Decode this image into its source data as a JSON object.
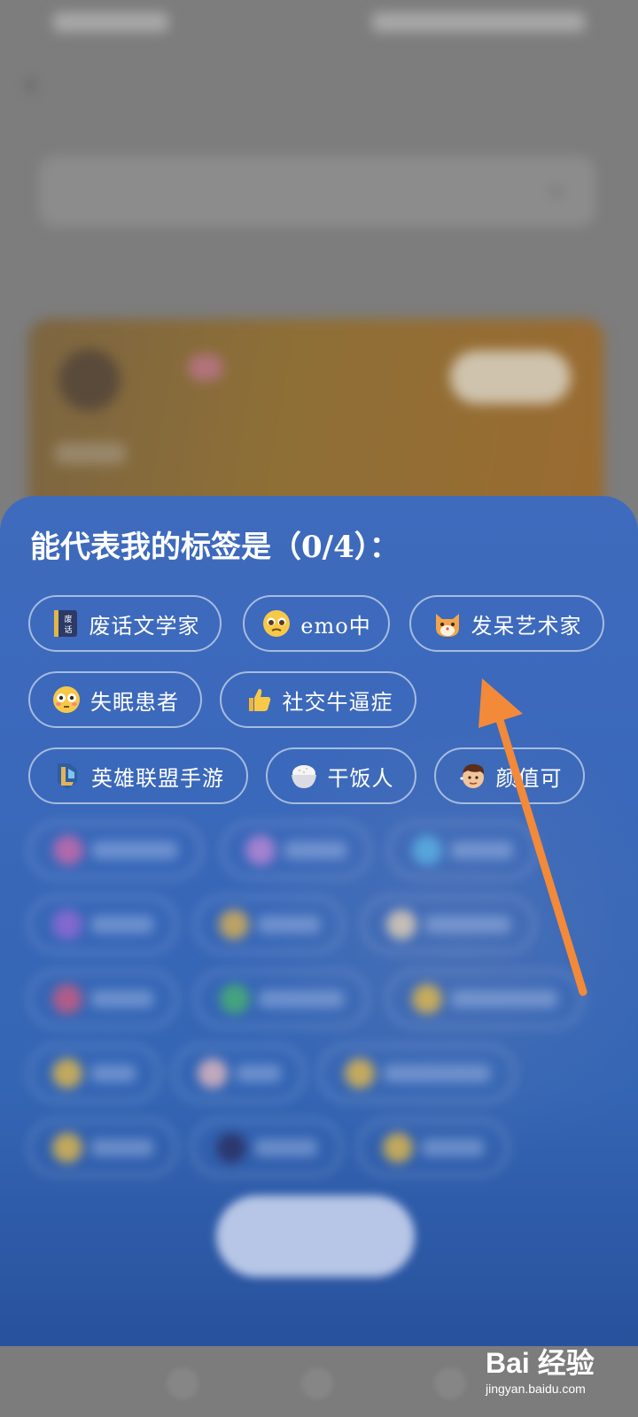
{
  "background_page": {
    "title": "",
    "select_text": "",
    "link_text": ""
  },
  "sheet": {
    "title": "能代表我的标签是（0/4）：",
    "selected_count": 0,
    "max_count": 4,
    "visible_tags": [
      {
        "label": "废话文学家",
        "icon": "book-icon"
      },
      {
        "label": "emo中",
        "icon": "pleading-face-icon"
      },
      {
        "label": "发呆艺术家",
        "icon": "cat-face-icon"
      },
      {
        "label": "失眠患者",
        "icon": "flushed-face-icon"
      },
      {
        "label": "社交牛逼症",
        "icon": "thumbs-up-icon"
      },
      {
        "label": "英雄联盟手游",
        "icon": "league-emblem-icon"
      },
      {
        "label": "干饭人",
        "icon": "rice-bowl-icon"
      },
      {
        "label": "颜值可",
        "icon": "handsome-guy-icon"
      }
    ],
    "confirm_label": ""
  },
  "watermark": {
    "brand": "Bai 经验",
    "url": "jingyan.baidu.com"
  },
  "colors": {
    "sheet_bg": "#3a68ba",
    "arrow": "#f28a3a",
    "tag_border": "rgba(255,255,255,0.55)"
  }
}
